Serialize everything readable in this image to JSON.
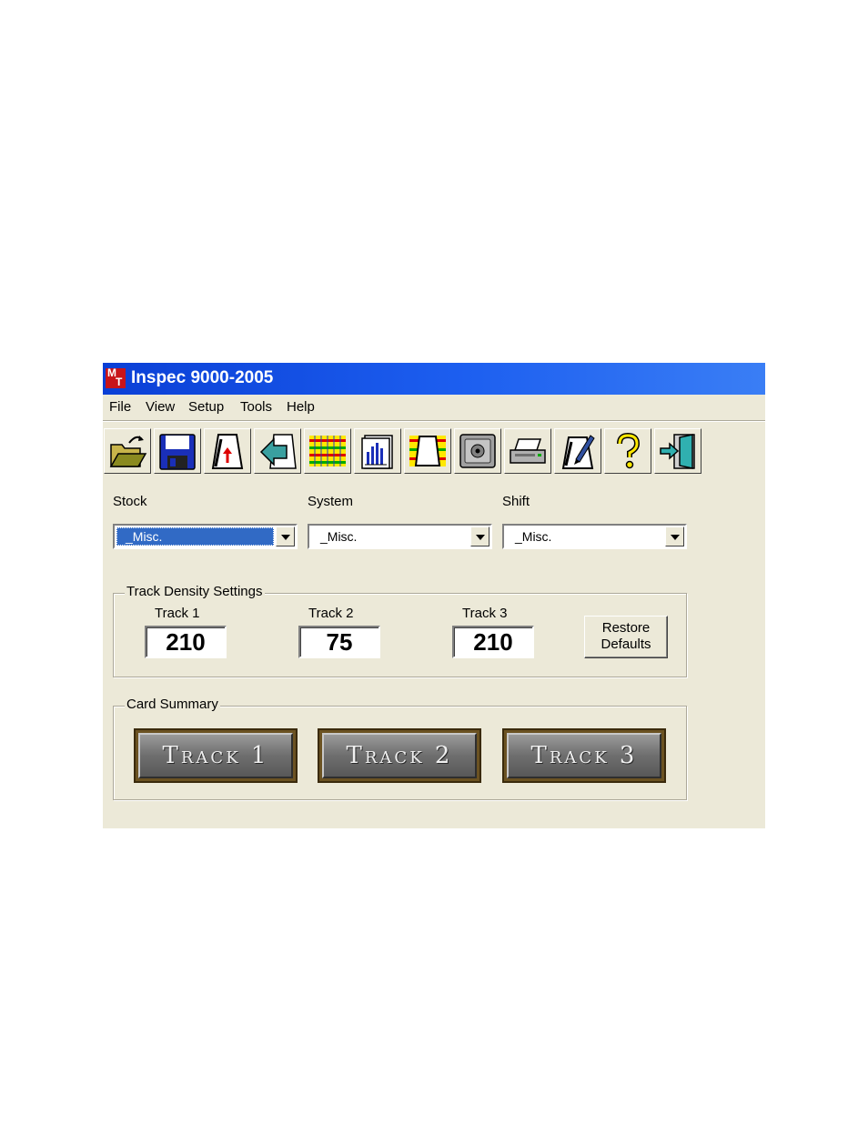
{
  "window": {
    "title": "Inspec 9000-2005",
    "app_icon": "MT-logo-icon"
  },
  "menu": [
    {
      "label": "File"
    },
    {
      "label": "View"
    },
    {
      "label": "Setup"
    },
    {
      "label": "Tools"
    },
    {
      "label": "Help"
    }
  ],
  "toolbar": [
    "open-folder-icon",
    "save-disk-icon",
    "track-upload-icon",
    "back-arrow-icon",
    "track-grid-icon",
    "bar-chart-doc-icon",
    "density-grid-icon",
    "safe-icon",
    "printer-icon",
    "edit-pen-icon",
    "help-question-icon",
    "exit-door-icon"
  ],
  "selectors": {
    "stock": {
      "label": "Stock",
      "value": "_Misc."
    },
    "system": {
      "label": "System",
      "value": "_Misc."
    },
    "shift": {
      "label": "Shift",
      "value": "_Misc."
    }
  },
  "density": {
    "legend": "Track Density Settings",
    "track1": {
      "label": "Track 1",
      "value": "210"
    },
    "track2": {
      "label": "Track 2",
      "value": "75"
    },
    "track3": {
      "label": "Track 3",
      "value": "210"
    },
    "restore_line1": "Restore",
    "restore_line2": "Defaults"
  },
  "summary": {
    "legend": "Card Summary",
    "buttons": [
      "Track 1",
      "Track 2",
      "Track 3"
    ]
  },
  "colors": {
    "titlebar": "#1d5ff0",
    "selection": "#316ac5",
    "window_bg": "#ece9d8"
  }
}
